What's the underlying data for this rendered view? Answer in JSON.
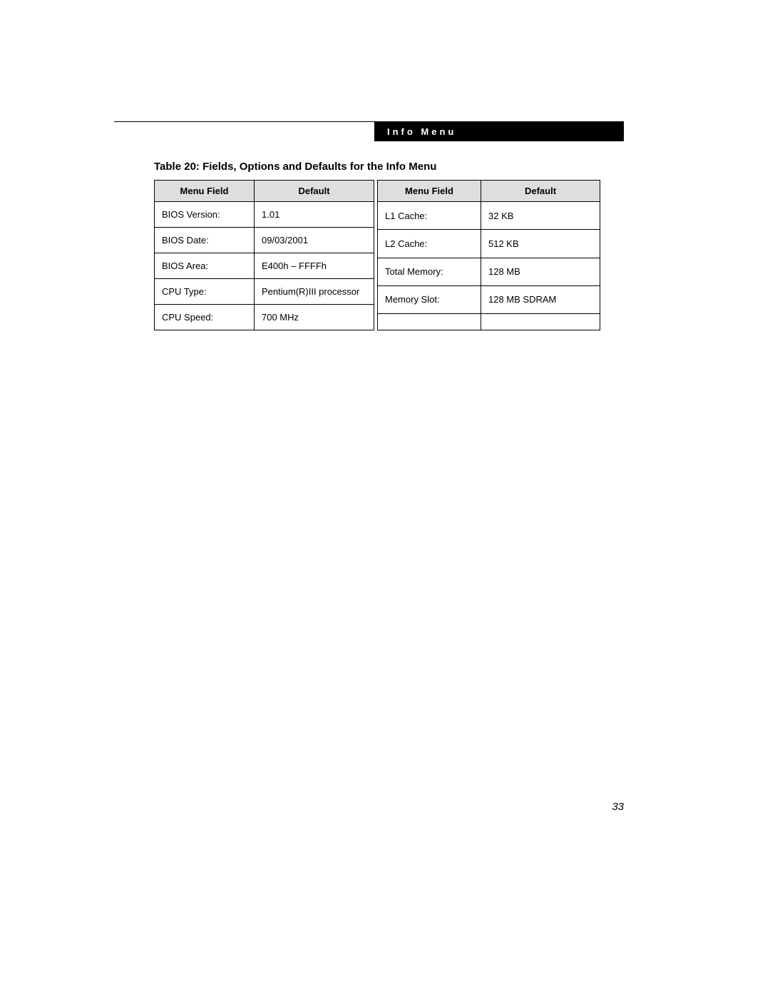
{
  "header": {
    "section_label": "Info Menu"
  },
  "table": {
    "title": "Table 20: Fields, Options and Defaults for the Info Menu",
    "columns": {
      "field": "Menu Field",
      "default": "Default"
    },
    "left_rows": [
      {
        "field": "BIOS Version:",
        "default": "1.01"
      },
      {
        "field": "BIOS Date:",
        "default": "09/03/2001"
      },
      {
        "field": "BIOS Area:",
        "default": "E400h – FFFFh"
      },
      {
        "field": "CPU Type:",
        "default": "Pentium(R)III processor"
      },
      {
        "field": "CPU Speed:",
        "default": "700 MHz"
      }
    ],
    "right_rows": [
      {
        "field": "L1 Cache:",
        "default": "32 KB"
      },
      {
        "field": "L2 Cache:",
        "default": "512 KB"
      },
      {
        "field": "Total Memory:",
        "default": "128 MB"
      },
      {
        "field": "Memory Slot:",
        "default": "128 MB SDRAM"
      },
      {
        "field": "",
        "default": ""
      }
    ]
  },
  "page_number": "33"
}
